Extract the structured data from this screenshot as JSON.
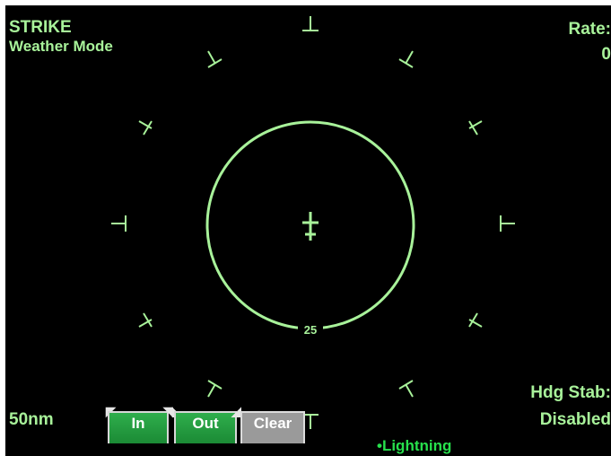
{
  "header": {
    "mode_title": "STRIKE",
    "mode_subtitle": "Weather Mode",
    "rate_label": "Rate:",
    "rate_value": "0"
  },
  "footer": {
    "range": "50nm",
    "hdg_stab_label": "Hdg Stab:",
    "hdg_stab_value": "Disabled",
    "legend": "•Lightning"
  },
  "radar": {
    "ring_label": "25",
    "ring_color": "#a8f29a"
  },
  "softkeys": {
    "in": "In",
    "out": "Out",
    "clear": "Clear"
  },
  "colors": {
    "display": "#a8f29a",
    "background": "#000000",
    "softkey_green": "#1f9a3c",
    "softkey_grey": "#9a9a9a",
    "legend": "#27e04c"
  }
}
